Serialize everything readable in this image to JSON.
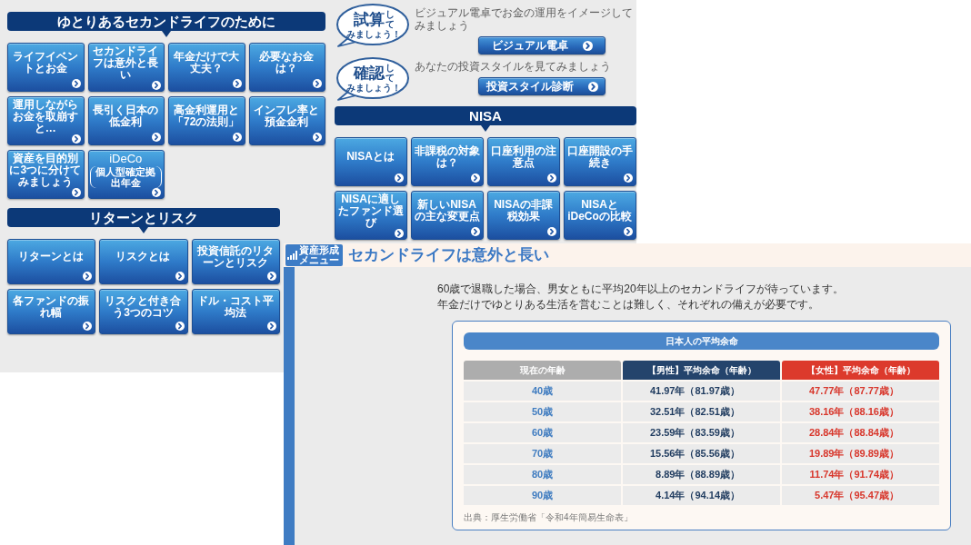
{
  "menu_panel": {
    "left_sections": [
      {
        "title": "ゆとりあるセカンドライフのために",
        "tiles": [
          {
            "label": "ライフイベントとお金"
          },
          {
            "label": "セカンドライフは意外と長い"
          },
          {
            "label": "年金だけで大丈夫？"
          },
          {
            "label": "必要なお金は？"
          },
          {
            "label": "運用しながらお金を取崩すと…"
          },
          {
            "label": "長引く日本の低金利"
          },
          {
            "label": "高金利運用と「72の法則」"
          },
          {
            "label": "インフレ率と預金金利"
          },
          {
            "label": "資産を目的別に3つに分けてみましょう"
          },
          {
            "label": "iDeCo",
            "sublabel": "個人型確定拠出年金"
          }
        ]
      },
      {
        "title": "リターンとリスク",
        "tiles": [
          {
            "label": "リターンとは"
          },
          {
            "label": "リスクとは"
          },
          {
            "label": "投資信託のリターンとリスク"
          },
          {
            "label": "各ファンドの振れ幅"
          },
          {
            "label": "リスクと付き合う3つのコツ"
          },
          {
            "label": "ドル・コスト平均法"
          }
        ]
      }
    ],
    "actions": [
      {
        "badge": {
          "main": "試算",
          "side": "して",
          "sub": "みましょう！"
        },
        "description": "ビジュアル電卓でお金の運用をイメージしてみましょう",
        "button": "ビジュアル電卓"
      },
      {
        "badge": {
          "main": "確認",
          "side": "して",
          "sub": "みましょう！"
        },
        "description": "あなたの投資スタイルを見てみましょう",
        "button": "投資スタイル診断"
      }
    ],
    "nisa_section": {
      "title": "NISA",
      "tiles": [
        {
          "label": "NISAとは"
        },
        {
          "label": "非課税の対象は？"
        },
        {
          "label": "口座利用の注意点"
        },
        {
          "label": "口座開設の手続き"
        },
        {
          "label": "NISAに適したファンド選び"
        },
        {
          "label": "新しいNISAの主な変更点"
        },
        {
          "label": "NISAの非課税効果"
        },
        {
          "label": "NISAとiDeCoの比較"
        }
      ]
    }
  },
  "article": {
    "menu_button": "資産形成メニュー",
    "title": "セカンドライフは意外と長い",
    "intro": [
      "60歳で退職した場合、男女ともに平均20年以上のセカンドライフが待っています。",
      "年金だけでゆとりある生活を営むことは難しく、それぞれの備えが必要です。"
    ],
    "table": {
      "title": "日本人の平均余命",
      "columns": [
        {
          "label": "現在の年齢",
          "kind": "age"
        },
        {
          "label": "【男性】平均余命（年齢）",
          "kind": "male"
        },
        {
          "label": "【女性】平均余命（年齢）",
          "kind": "female"
        }
      ],
      "rows": [
        [
          "40歳",
          "41.97年（81.97歳）",
          "47.77年（87.77歳）"
        ],
        [
          "50歳",
          "32.51年（82.51歳）",
          "38.16年（88.16歳）"
        ],
        [
          "60歳",
          "23.59年（83.59歳）",
          "28.84年（88.84歳）"
        ],
        [
          "70歳",
          "15.56年（85.56歳）",
          "19.89年（89.89歳）"
        ],
        [
          "80歳",
          "8.89年（88.89歳）",
          "11.74年（91.74歳）"
        ],
        [
          "90歳",
          "4.14年（94.14歳）",
          "5.47年（95.47歳）"
        ]
      ],
      "source": "出典：厚生労働省「令和4年簡易生命表」"
    }
  }
}
